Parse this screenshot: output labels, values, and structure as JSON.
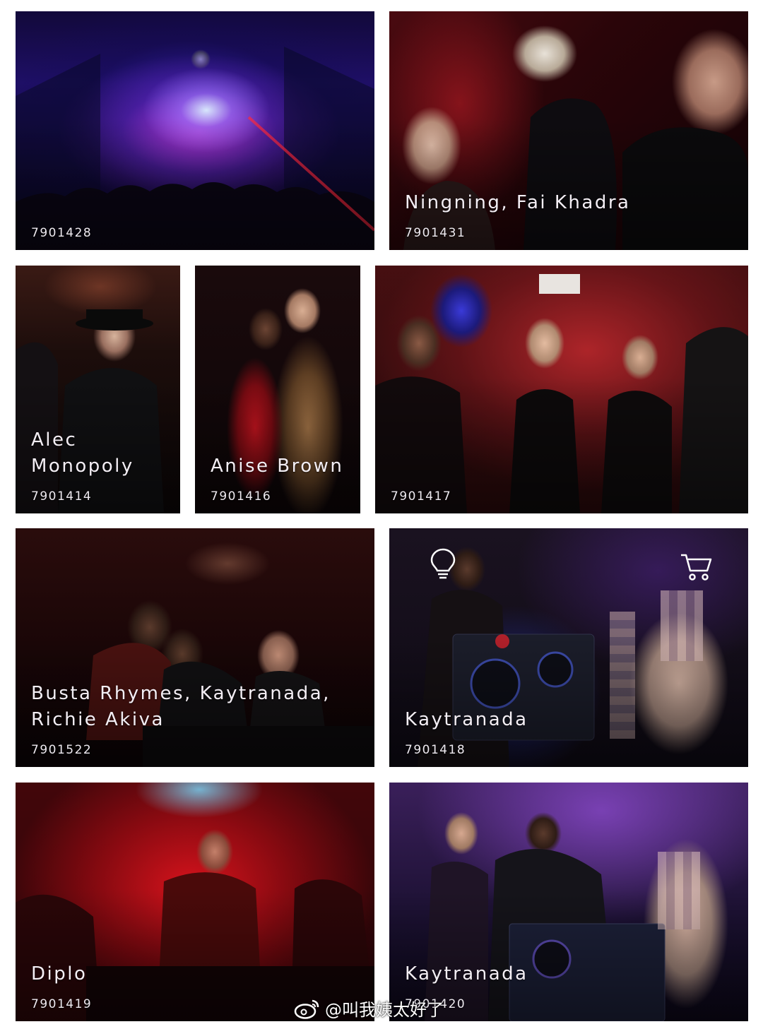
{
  "tiles": [
    {
      "name": "",
      "code": "7901428"
    },
    {
      "name": "Ningning, Fai Khadra",
      "code": "7901431"
    },
    {
      "name": "Alec\nMonopoly",
      "code": "7901414"
    },
    {
      "name": "Anise Brown",
      "code": "7901416"
    },
    {
      "name": "",
      "code": "7901417"
    },
    {
      "name": "Busta Rhymes, Kaytranada,\nRichie Akiva",
      "code": "7901522"
    },
    {
      "name": "Kaytranada",
      "code": "7901418"
    },
    {
      "name": "Diplo",
      "code": "7901419"
    },
    {
      "name": "Kaytranada",
      "code": "7901420"
    }
  ],
  "icons": {
    "lightbulb": "lightbulb-icon",
    "cart": "shopping-cart-icon",
    "weibo": "weibo-logo-icon"
  },
  "watermark": {
    "text": "@叫我姨太好了"
  },
  "colors": {
    "background": "#ffffff",
    "caption": "#f3eef4"
  }
}
